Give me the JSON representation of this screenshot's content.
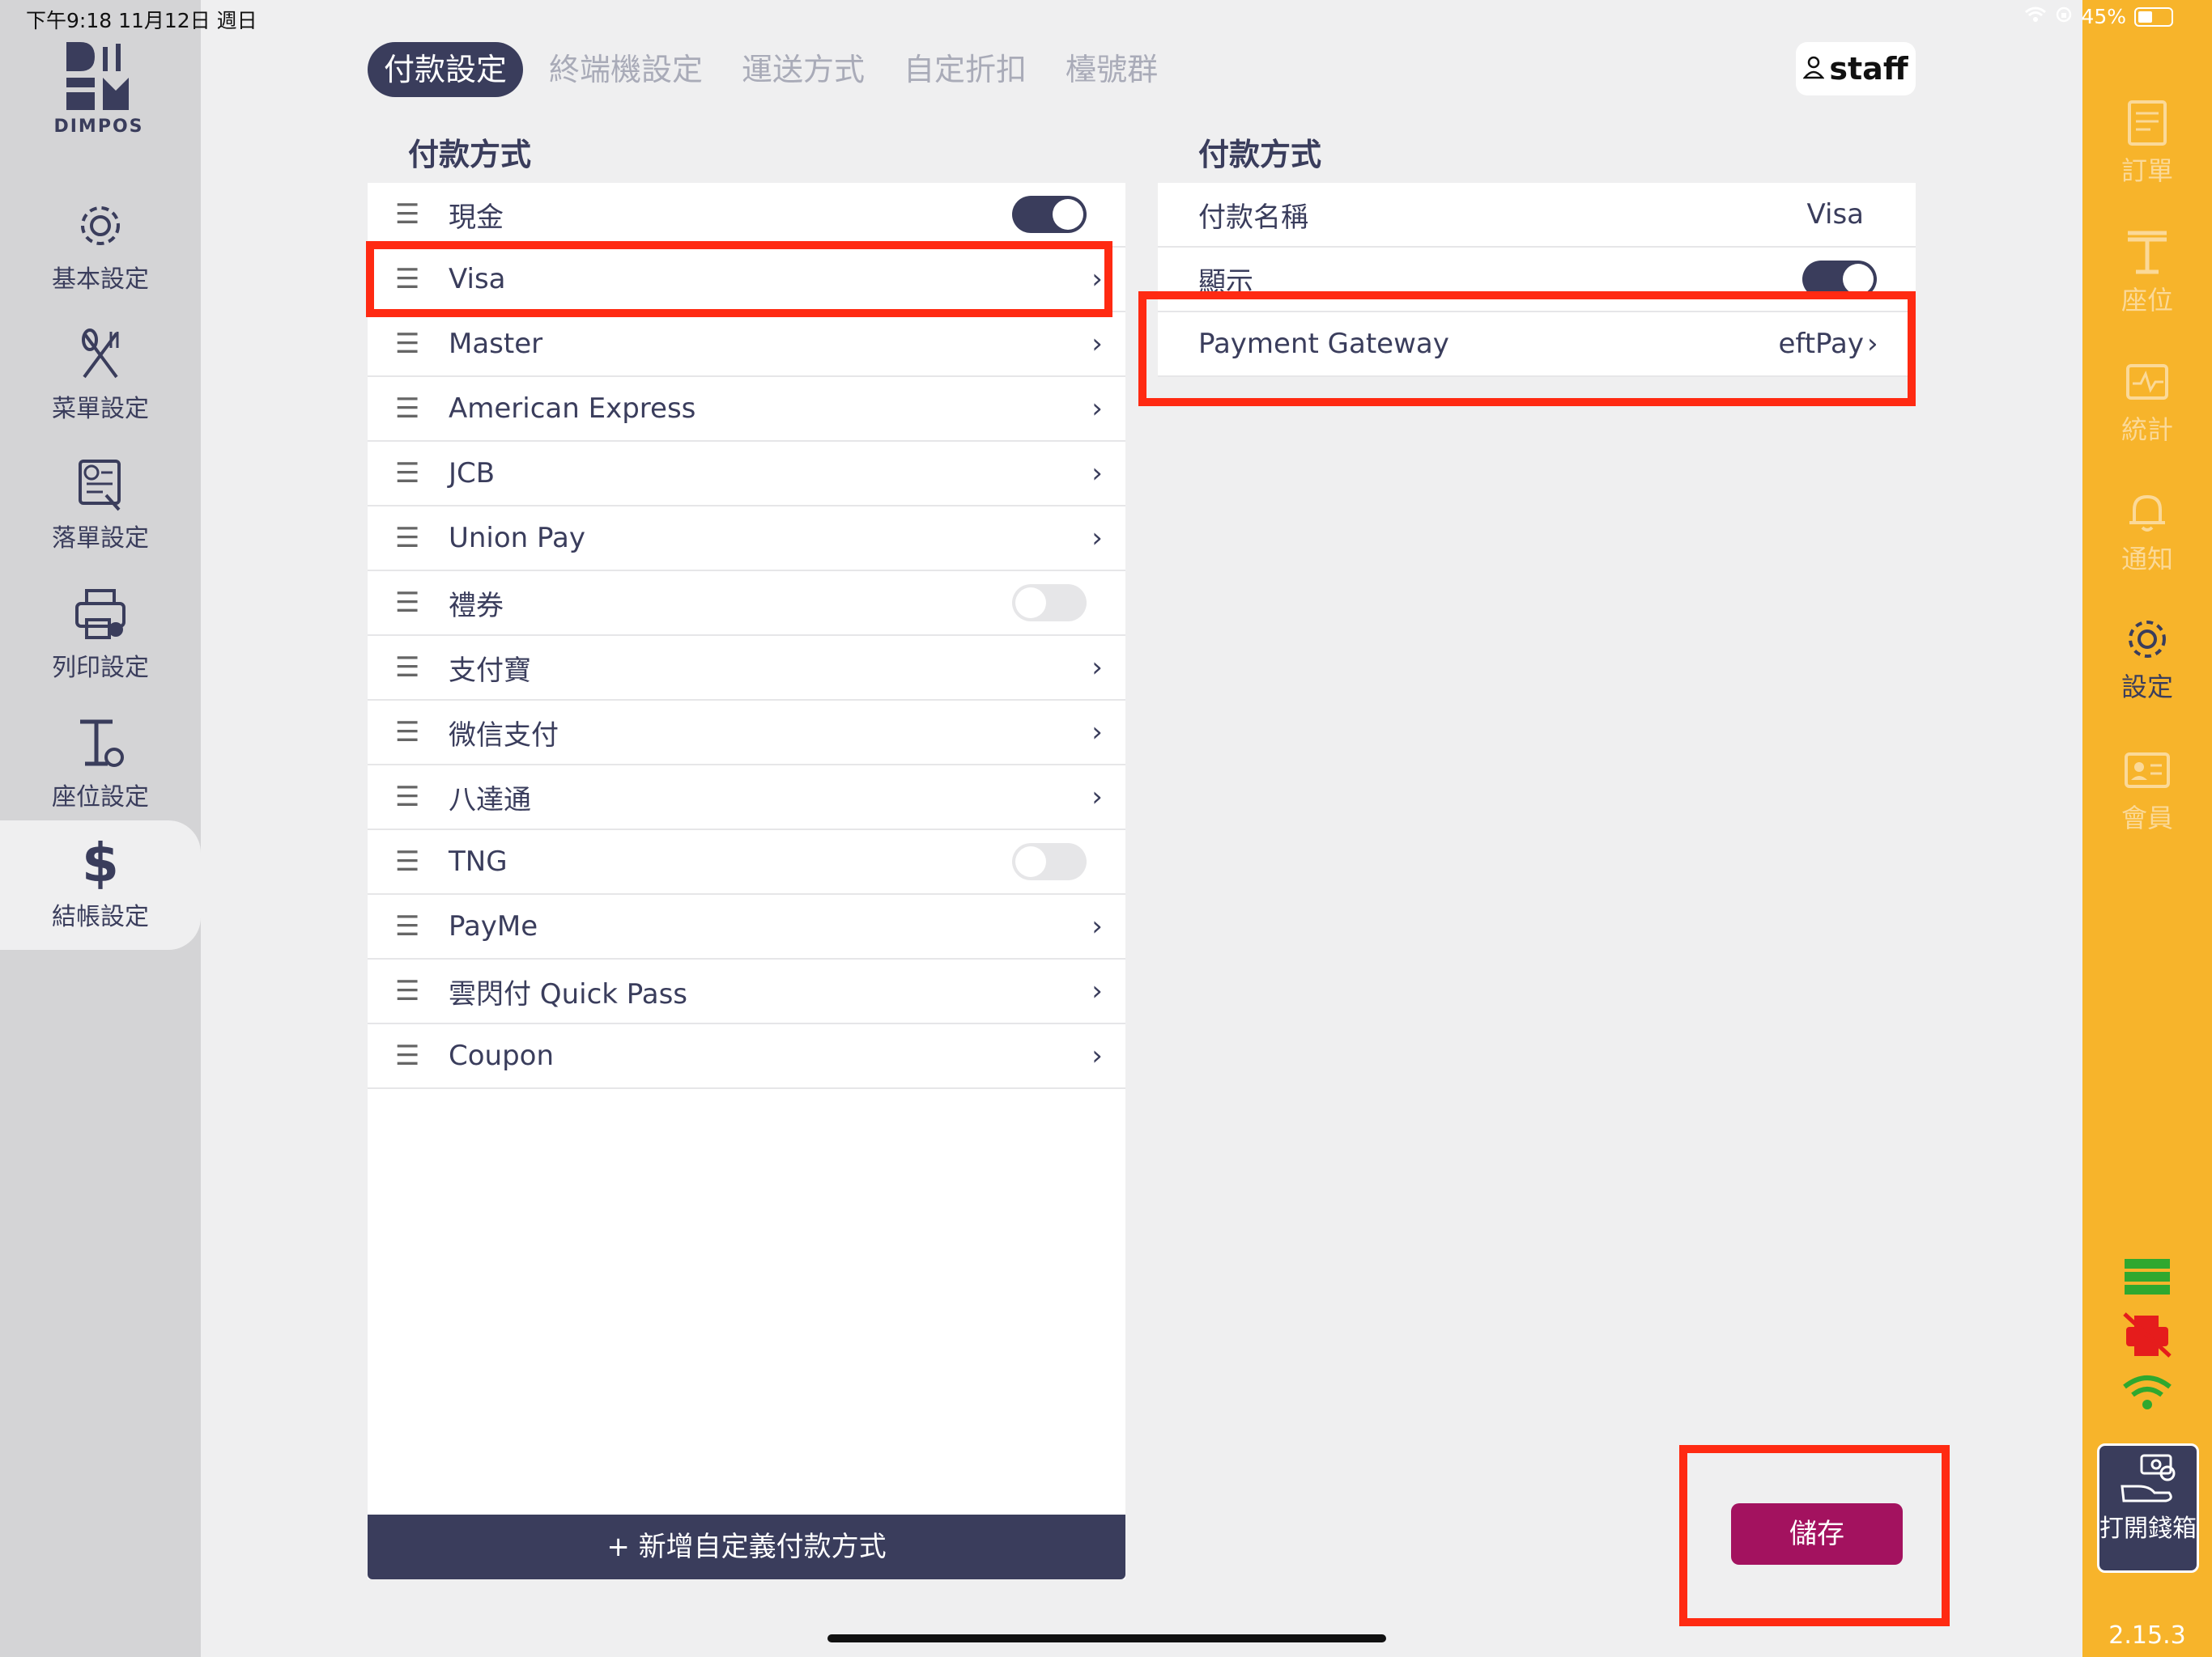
{
  "status_bar": {
    "time_date": "下午9:18   11月12日 週日",
    "battery": "45%",
    "battery_level": 0.45
  },
  "brand": {
    "name": "DIMPOS"
  },
  "left_nav": {
    "items": [
      {
        "label": "基本設定",
        "icon": "gear-icon"
      },
      {
        "label": "菜單設定",
        "icon": "fork-knife-icon"
      },
      {
        "label": "落單設定",
        "icon": "order-settings-icon"
      },
      {
        "label": "列印設定",
        "icon": "printer-settings-icon"
      },
      {
        "label": "座位設定",
        "icon": "table-settings-icon"
      },
      {
        "label": "結帳設定",
        "icon": "dollar-icon",
        "active": true
      }
    ]
  },
  "tabs": [
    {
      "label": "付款設定",
      "active": true
    },
    {
      "label": "終端機設定"
    },
    {
      "label": "運送方式"
    },
    {
      "label": "自定折扣"
    },
    {
      "label": "檯號群"
    }
  ],
  "user": {
    "label": "staff",
    "icon": "user-icon"
  },
  "payment_methods": {
    "title": "付款方式",
    "items": [
      {
        "label": "現金",
        "control": "toggle",
        "on": true
      },
      {
        "label": "Visa",
        "control": "chevron"
      },
      {
        "label": "Master",
        "control": "chevron"
      },
      {
        "label": "American Express",
        "control": "chevron"
      },
      {
        "label": "JCB",
        "control": "chevron"
      },
      {
        "label": "Union Pay",
        "control": "chevron"
      },
      {
        "label": "禮券",
        "control": "toggle",
        "on": false
      },
      {
        "label": "支付寶",
        "control": "chevron"
      },
      {
        "label": "微信支付",
        "control": "chevron"
      },
      {
        "label": "八達通",
        "control": "chevron"
      },
      {
        "label": "TNG",
        "control": "toggle",
        "on": false
      },
      {
        "label": "PayMe",
        "control": "chevron"
      },
      {
        "label": "雲閃付 Quick Pass",
        "control": "chevron"
      },
      {
        "label": "Coupon",
        "control": "chevron"
      }
    ],
    "add_label": "+ 新增自定義付款方式"
  },
  "detail": {
    "title": "付款方式",
    "name_label": "付款名稱",
    "name_value": "Visa",
    "display_label": "顯示",
    "display_on": true,
    "gateway_label": "Payment Gateway",
    "gateway_value": "eftPay"
  },
  "save_label": "儲存",
  "right_nav": {
    "items": [
      {
        "label": "訂單",
        "icon": "order-icon"
      },
      {
        "label": "座位",
        "icon": "seat-icon"
      },
      {
        "label": "統計",
        "icon": "stats-icon"
      },
      {
        "label": "通知",
        "icon": "bell-icon"
      },
      {
        "label": "設定",
        "icon": "gear-icon",
        "active": true
      },
      {
        "label": "會員",
        "icon": "member-card-icon"
      }
    ],
    "cash_drawer_label": "打開錢箱",
    "version": "2.15.3"
  },
  "colors": {
    "primary": "#3a3d5c",
    "accent": "#f7b42b",
    "save": "#a3125f",
    "highlight": "#ff2a12"
  }
}
